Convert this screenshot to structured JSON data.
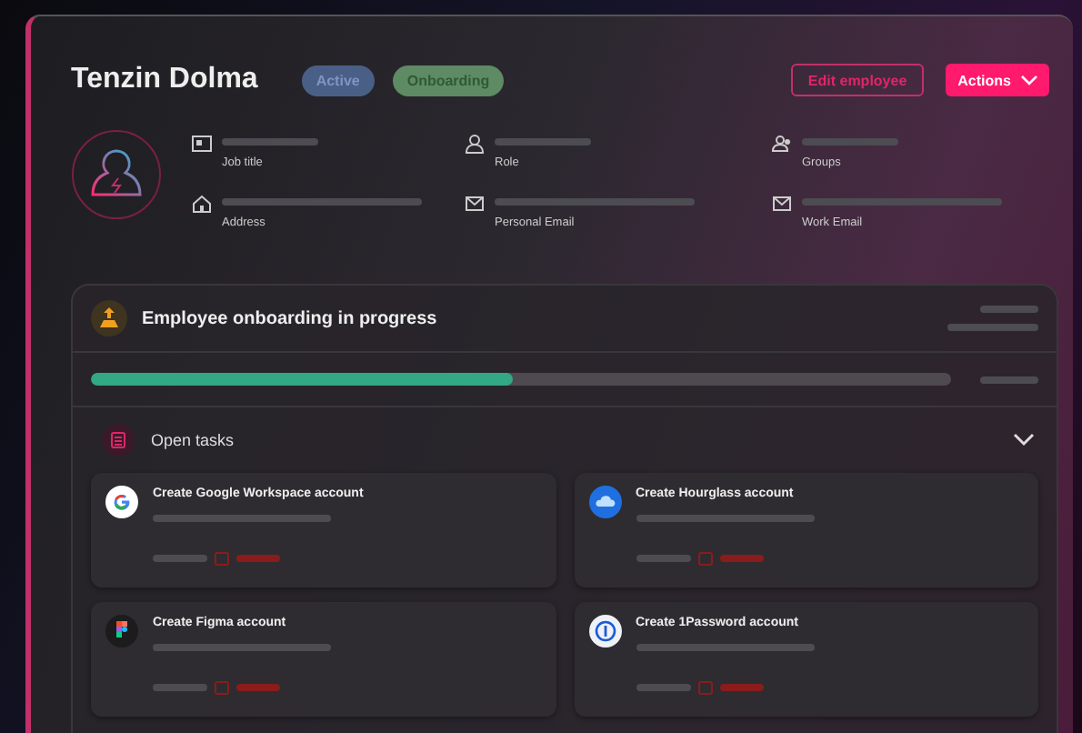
{
  "employee": {
    "name": "Tenzin Dolma",
    "badges": [
      {
        "label": "Active",
        "color": "#4a5f86"
      },
      {
        "label": "Onboarding",
        "color": "#5e8a64"
      }
    ]
  },
  "buttons": [
    {
      "label": "Edit employee",
      "kind": "outline"
    },
    {
      "label": "Actions",
      "kind": "filled"
    }
  ],
  "fields": [
    {
      "label": "Job title",
      "kind": "id"
    },
    {
      "label": "Role",
      "kind": "person"
    },
    {
      "label": "Groups",
      "kind": "group"
    },
    {
      "label": "Address",
      "kind": "home"
    },
    {
      "label": "Personal Email",
      "kind": "mail"
    },
    {
      "label": "Work Email",
      "kind": "mail"
    }
  ],
  "onboarding": {
    "title": "Employee onboarding in progress",
    "level": 0.49,
    "open_tasks": {
      "label": "Open tasks",
      "expanded": true,
      "tasks": [
        {
          "title": "Create Google Workspace account",
          "kind": "google"
        },
        {
          "title": "Create Hourglass account",
          "kind": "hourglass"
        },
        {
          "title": "Create Figma account",
          "kind": "figma"
        },
        {
          "title": "Create 1Password account",
          "kind": "password"
        }
      ]
    }
  }
}
